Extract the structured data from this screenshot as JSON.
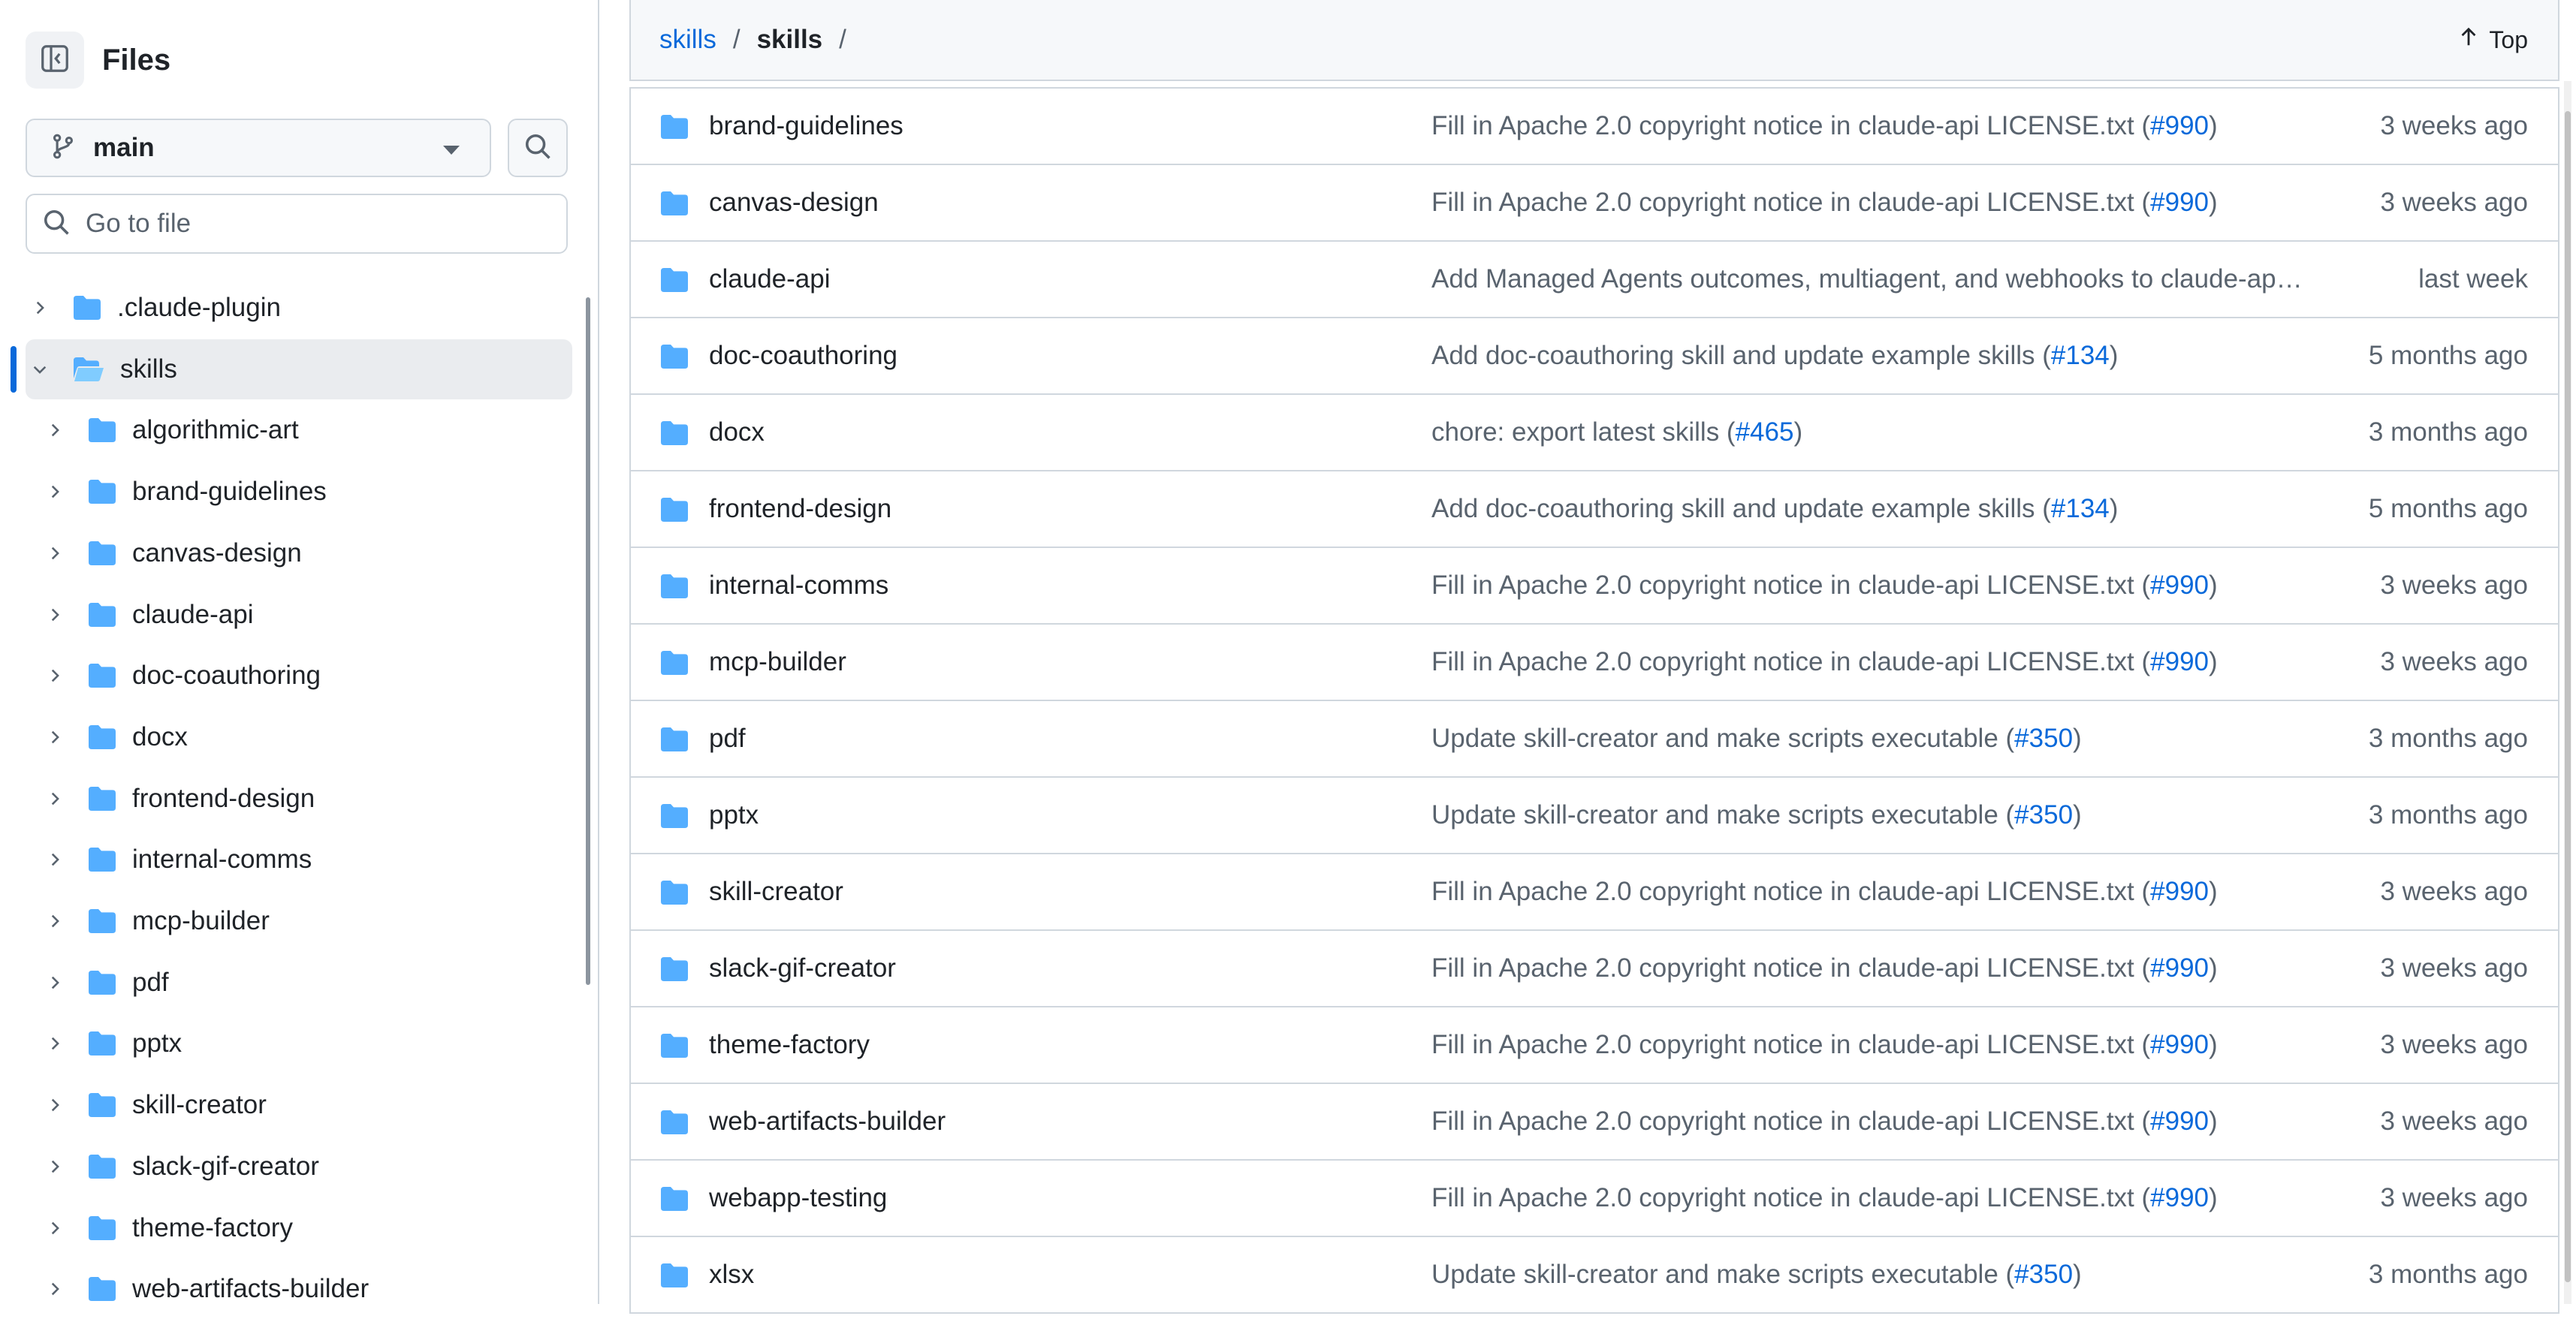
{
  "sidebar": {
    "title": "Files",
    "branch": "main",
    "goto_placeholder": "Go to file",
    "tree": [
      {
        "label": ".claude-plugin",
        "level": 0,
        "expanded": false,
        "selected": false
      },
      {
        "label": "skills",
        "level": 0,
        "expanded": true,
        "selected": true
      },
      {
        "label": "algorithmic-art",
        "level": 1,
        "expanded": false,
        "selected": false
      },
      {
        "label": "brand-guidelines",
        "level": 1,
        "expanded": false,
        "selected": false
      },
      {
        "label": "canvas-design",
        "level": 1,
        "expanded": false,
        "selected": false
      },
      {
        "label": "claude-api",
        "level": 1,
        "expanded": false,
        "selected": false
      },
      {
        "label": "doc-coauthoring",
        "level": 1,
        "expanded": false,
        "selected": false
      },
      {
        "label": "docx",
        "level": 1,
        "expanded": false,
        "selected": false
      },
      {
        "label": "frontend-design",
        "level": 1,
        "expanded": false,
        "selected": false
      },
      {
        "label": "internal-comms",
        "level": 1,
        "expanded": false,
        "selected": false
      },
      {
        "label": "mcp-builder",
        "level": 1,
        "expanded": false,
        "selected": false
      },
      {
        "label": "pdf",
        "level": 1,
        "expanded": false,
        "selected": false
      },
      {
        "label": "pptx",
        "level": 1,
        "expanded": false,
        "selected": false
      },
      {
        "label": "skill-creator",
        "level": 1,
        "expanded": false,
        "selected": false
      },
      {
        "label": "slack-gif-creator",
        "level": 1,
        "expanded": false,
        "selected": false
      },
      {
        "label": "theme-factory",
        "level": 1,
        "expanded": false,
        "selected": false
      },
      {
        "label": "web-artifacts-builder",
        "level": 1,
        "expanded": false,
        "selected": false
      }
    ]
  },
  "breadcrumb": {
    "root": "skills",
    "sep1": "/",
    "current": "skills",
    "sep2": "/",
    "top_label": "Top"
  },
  "files": [
    {
      "name": "brand-guidelines",
      "msg": "Fill in Apache 2.0 copyright notice in claude-api LICENSE.txt (",
      "pr": "#990",
      "msg_end": ")",
      "age": "3 weeks ago"
    },
    {
      "name": "canvas-design",
      "msg": "Fill in Apache 2.0 copyright notice in claude-api LICENSE.txt (",
      "pr": "#990",
      "msg_end": ")",
      "age": "3 weeks ago"
    },
    {
      "name": "claude-api",
      "msg": "Add Managed Agents outcomes, multiagent, and webhooks to claude-ap…",
      "pr": "",
      "msg_end": "",
      "age": "last week"
    },
    {
      "name": "doc-coauthoring",
      "msg": "Add doc-coauthoring skill and update example skills (",
      "pr": "#134",
      "msg_end": ")",
      "age": "5 months ago"
    },
    {
      "name": "docx",
      "msg": "chore: export latest skills (",
      "pr": "#465",
      "msg_end": ")",
      "age": "3 months ago"
    },
    {
      "name": "frontend-design",
      "msg": "Add doc-coauthoring skill and update example skills (",
      "pr": "#134",
      "msg_end": ")",
      "age": "5 months ago"
    },
    {
      "name": "internal-comms",
      "msg": "Fill in Apache 2.0 copyright notice in claude-api LICENSE.txt (",
      "pr": "#990",
      "msg_end": ")",
      "age": "3 weeks ago"
    },
    {
      "name": "mcp-builder",
      "msg": "Fill in Apache 2.0 copyright notice in claude-api LICENSE.txt (",
      "pr": "#990",
      "msg_end": ")",
      "age": "3 weeks ago"
    },
    {
      "name": "pdf",
      "msg": "Update skill-creator and make scripts executable (",
      "pr": "#350",
      "msg_end": ")",
      "age": "3 months ago"
    },
    {
      "name": "pptx",
      "msg": "Update skill-creator and make scripts executable (",
      "pr": "#350",
      "msg_end": ")",
      "age": "3 months ago"
    },
    {
      "name": "skill-creator",
      "msg": "Fill in Apache 2.0 copyright notice in claude-api LICENSE.txt (",
      "pr": "#990",
      "msg_end": ")",
      "age": "3 weeks ago"
    },
    {
      "name": "slack-gif-creator",
      "msg": "Fill in Apache 2.0 copyright notice in claude-api LICENSE.txt (",
      "pr": "#990",
      "msg_end": ")",
      "age": "3 weeks ago"
    },
    {
      "name": "theme-factory",
      "msg": "Fill in Apache 2.0 copyright notice in claude-api LICENSE.txt (",
      "pr": "#990",
      "msg_end": ")",
      "age": "3 weeks ago"
    },
    {
      "name": "web-artifacts-builder",
      "msg": "Fill in Apache 2.0 copyright notice in claude-api LICENSE.txt (",
      "pr": "#990",
      "msg_end": ")",
      "age": "3 weeks ago"
    },
    {
      "name": "webapp-testing",
      "msg": "Fill in Apache 2.0 copyright notice in claude-api LICENSE.txt (",
      "pr": "#990",
      "msg_end": ")",
      "age": "3 weeks ago"
    },
    {
      "name": "xlsx",
      "msg": "Update skill-creator and make scripts executable (",
      "pr": "#350",
      "msg_end": ")",
      "age": "3 months ago"
    }
  ],
  "icons": {
    "panel": "sidebar-collapse-icon",
    "branch": "git-branch-icon",
    "search": "search-icon",
    "folder": "folder-icon",
    "folder_open": "folder-open-icon",
    "chevron_right": "chevron-right-icon",
    "chevron_down": "chevron-down-icon",
    "arrow_up": "arrow-up-icon"
  },
  "colors": {
    "accent": "#0969da",
    "folder": "#54aeff",
    "border": "#d0d7de",
    "muted_text": "#59636e",
    "selected_bg": "#eaecef"
  }
}
